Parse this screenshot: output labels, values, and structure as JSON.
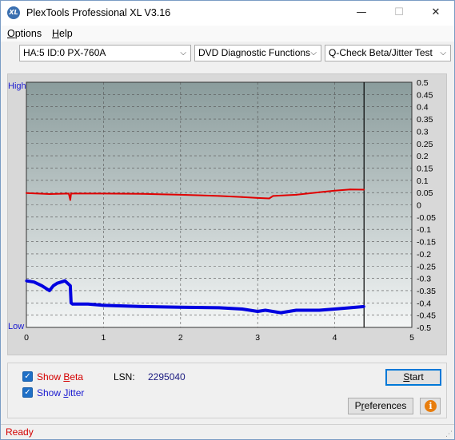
{
  "window": {
    "title": "PlexTools Professional XL V3.16",
    "icon_text": "XL",
    "min_glyph": "—",
    "max_glyph": "☐",
    "close_glyph": "✕"
  },
  "menu": {
    "options_accel": "O",
    "options_rest": "ptions",
    "help_accel": "H",
    "help_rest": "elp"
  },
  "toolbar": {
    "drive": "HA:5 ID:0  PX-760A",
    "function": "DVD Diagnostic Functions",
    "test": "Q-Check Beta/Jitter Test",
    "arrow": "⌵"
  },
  "chart": {
    "high_label": "High",
    "low_label": "Low"
  },
  "chart_data": {
    "type": "line",
    "x_ticks": [
      "0",
      "1",
      "2",
      "3",
      "4",
      "5"
    ],
    "xlim": [
      0,
      5
    ],
    "y_right_ticks": [
      "0.5",
      "0.45",
      "0.4",
      "0.35",
      "0.3",
      "0.25",
      "0.2",
      "0.15",
      "0.1",
      "0.05",
      "0",
      "-0.05",
      "-0.1",
      "-0.15",
      "-0.2",
      "-0.25",
      "-0.3",
      "-0.35",
      "-0.4",
      "-0.45",
      "-0.5"
    ],
    "ylim": [
      -0.5,
      0.5
    ],
    "end_marker_x": 4.38,
    "grid": true,
    "series": [
      {
        "name": "Beta",
        "color": "#e00000",
        "x": [
          0,
          0.3,
          0.55,
          0.57,
          0.58,
          0.6,
          1.0,
          1.5,
          2.0,
          2.5,
          2.8,
          3.0,
          3.15,
          3.2,
          3.5,
          3.8,
          4.0,
          4.2,
          4.38
        ],
        "y": [
          0.048,
          0.044,
          0.046,
          0.02,
          0.046,
          0.046,
          0.046,
          0.045,
          0.041,
          0.036,
          0.032,
          0.028,
          0.026,
          0.036,
          0.041,
          0.051,
          0.058,
          0.063,
          0.062
        ]
      },
      {
        "name": "Jitter",
        "color": "#0000e0",
        "x": [
          0,
          0.1,
          0.2,
          0.3,
          0.35,
          0.4,
          0.5,
          0.57,
          0.58,
          0.6,
          0.8,
          1.0,
          1.5,
          2.0,
          2.5,
          2.8,
          3.0,
          3.1,
          3.3,
          3.5,
          3.8,
          4.0,
          4.2,
          4.38
        ],
        "y": [
          -0.31,
          -0.315,
          -0.33,
          -0.35,
          -0.33,
          -0.32,
          -0.31,
          -0.33,
          -0.4,
          -0.405,
          -0.405,
          -0.41,
          -0.415,
          -0.418,
          -0.42,
          -0.425,
          -0.435,
          -0.43,
          -0.44,
          -0.43,
          -0.43,
          -0.425,
          -0.42,
          -0.415
        ]
      }
    ]
  },
  "controls": {
    "show_beta_prefix": "Show ",
    "show_beta_accel": "B",
    "show_beta_rest": "eta",
    "show_jitter_prefix": "Show ",
    "show_jitter_accel": "J",
    "show_jitter_rest": "itter",
    "check_glyph": "✓",
    "lsn_label": "LSN:",
    "lsn_value": "2295040",
    "start_accel": "S",
    "start_rest": "tart",
    "prefs_prefix": "P",
    "prefs_accel": "r",
    "prefs_rest": "eferences",
    "info_glyph": "i"
  },
  "status": {
    "text": "Ready",
    "grip": "⋰"
  }
}
